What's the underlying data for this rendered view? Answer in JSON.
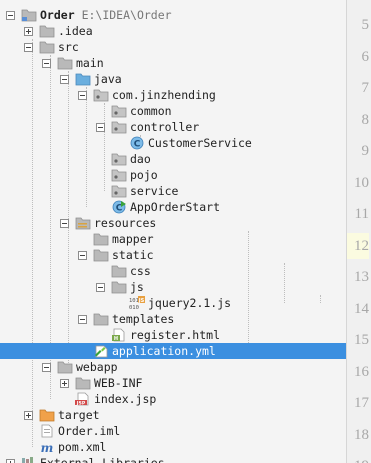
{
  "tree": [
    {
      "label": "Order",
      "path": "E:\\IDEA\\Order",
      "icon": "project-folder-icon",
      "toggle": "minus",
      "bold": true
    },
    {
      "label": ".idea",
      "icon": "folder-icon",
      "toggle": "plus"
    },
    {
      "label": "src",
      "icon": "folder-icon",
      "toggle": "minus"
    },
    {
      "label": "main",
      "icon": "folder-icon",
      "toggle": "minus"
    },
    {
      "label": "java",
      "icon": "source-folder-icon",
      "toggle": "minus"
    },
    {
      "label": "com.jinzhending",
      "icon": "package-icon",
      "toggle": "minus"
    },
    {
      "label": "common",
      "icon": "package-icon",
      "toggle": null
    },
    {
      "label": "controller",
      "icon": "package-icon",
      "toggle": "minus"
    },
    {
      "label": "CustomerService",
      "icon": "java-class-icon",
      "toggle": null
    },
    {
      "label": "dao",
      "icon": "package-icon",
      "toggle": null
    },
    {
      "label": "pojo",
      "icon": "package-icon",
      "toggle": null
    },
    {
      "label": "service",
      "icon": "package-icon",
      "toggle": null
    },
    {
      "label": "AppOrderStart",
      "icon": "spring-boot-class-icon",
      "toggle": null
    },
    {
      "label": "resources",
      "icon": "resources-folder-icon",
      "toggle": "minus"
    },
    {
      "label": "mapper",
      "icon": "folder-icon",
      "toggle": null
    },
    {
      "label": "static",
      "icon": "folder-icon",
      "toggle": "minus"
    },
    {
      "label": "css",
      "icon": "folder-icon",
      "toggle": null
    },
    {
      "label": "js",
      "icon": "folder-icon",
      "toggle": "minus"
    },
    {
      "label": "jquery2.1.js",
      "icon": "js-file-icon",
      "toggle": null
    },
    {
      "label": "templates",
      "icon": "folder-icon",
      "toggle": "minus"
    },
    {
      "label": "register.html",
      "icon": "html-file-icon",
      "toggle": null
    },
    {
      "label": "application.yml",
      "icon": "yml-file-icon",
      "toggle": null,
      "selected": true
    },
    {
      "label": "webapp",
      "icon": "folder-icon",
      "toggle": "minus"
    },
    {
      "label": "WEB-INF",
      "icon": "folder-icon",
      "toggle": "plus"
    },
    {
      "label": "index.jsp",
      "icon": "jsp-file-icon",
      "toggle": null
    },
    {
      "label": "target",
      "icon": "excluded-folder-icon",
      "toggle": "plus"
    },
    {
      "label": "Order.iml",
      "icon": "iml-file-icon",
      "toggle": null
    },
    {
      "label": "pom.xml",
      "icon": "maven-file-icon",
      "toggle": null
    },
    {
      "label": "External Libraries",
      "icon": "libraries-icon",
      "toggle": "plus"
    }
  ],
  "gutter": {
    "lines": [
      "5",
      "6",
      "7",
      "8",
      "9",
      "10",
      "11",
      "12",
      "13",
      "14",
      "15",
      "16",
      "17",
      "18",
      "19"
    ],
    "current": "12"
  },
  "colors": {
    "selection": "#3b8fe0",
    "folder": "#b5b5b5",
    "source": "#6aaede",
    "excluded": "#f0a14a",
    "class": "#3c95d6"
  }
}
